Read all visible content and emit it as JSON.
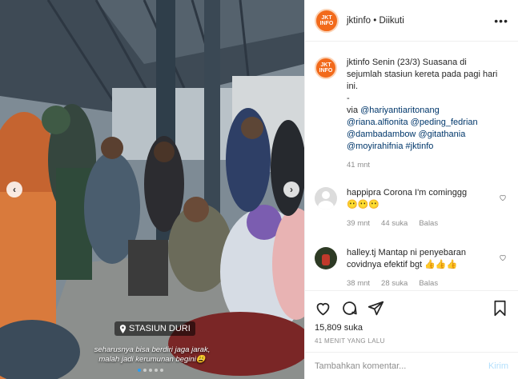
{
  "colors": {
    "accent": "#0095f6",
    "brand": "#f26a1b",
    "link": "#00376b",
    "muted": "#8e8e8e"
  },
  "media": {
    "location": "STASIUN DURI",
    "caption_line1": "seharusnya bisa berdiri jaga jarak,",
    "caption_line2": "malah jadi kerumunan begini😩",
    "slide_count": 5,
    "active_slide": 1
  },
  "header": {
    "avatar_text_1": "JKT",
    "avatar_text_2": "INFO",
    "username": "jktinfo",
    "separator": " • ",
    "follow_status": "Diikuti",
    "more_icon": "more-icon"
  },
  "caption": {
    "username": "jktinfo",
    "text": "Senin (23/3) Suasana di sejumlah stasiun kereta pada pagi hari ini.",
    "dash": "-",
    "via": "via",
    "mentions": [
      "@hariyantiaritonang",
      "@riana.alfionita",
      "@peding_fedrian",
      "@dambadambow",
      "@gitathania",
      "@moyirahifnia",
      "#jktinfo"
    ],
    "time": "41 mnt"
  },
  "comments": [
    {
      "username": "happipra",
      "text": "Corona I'm cominggg",
      "emoji": "😶😶😶",
      "time": "39 mnt",
      "likes": "44 suka",
      "reply": "Balas"
    },
    {
      "username": "halley.tj",
      "text": "Mantap ni penyebaran covidnya efektif bgt",
      "emoji": "👍👍👍",
      "time": "38 mnt",
      "likes": "28 suka",
      "reply": "Balas"
    }
  ],
  "actions": {
    "like_icon": "heart-icon",
    "comment_icon": "comment-icon",
    "share_icon": "share-icon",
    "save_icon": "bookmark-icon",
    "likes": "15,809 suka",
    "time_ago": "41 MENIT YANG LALU"
  },
  "composer": {
    "placeholder": "Tambahkan komentar...",
    "post_label": "Kirim"
  }
}
